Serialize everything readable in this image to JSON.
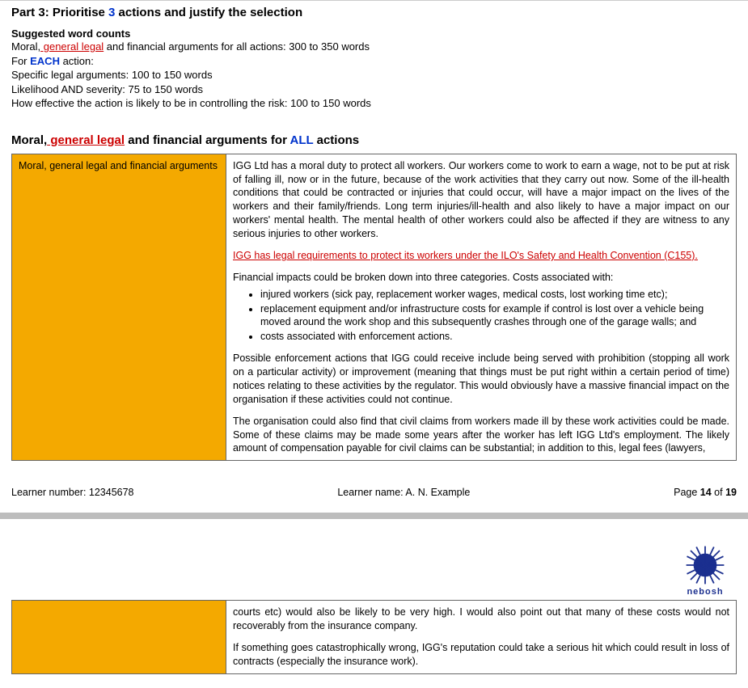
{
  "header": {
    "part_prefix": "Part 3: Prioritise ",
    "part_count": "3",
    "part_suffix": " actions and justify the selection"
  },
  "word_counts": {
    "title": "Suggested word counts",
    "line1_prefix": "Moral,",
    "line1_red": " general legal",
    "line1_suffix": " and financial arguments for all actions: 300 to 350 words",
    "each_prefix": "For ",
    "each_word": "EACH",
    "each_suffix": " action:",
    "line2": "Specific legal arguments: 100 to 150 words",
    "line3": "Likelihood AND severity: 75 to 150 words",
    "line4": "How effective the action is likely to be in controlling the risk: 100 to 150 words"
  },
  "section": {
    "prefix": "Moral,",
    "red": " general legal",
    "mid": " and financial arguments for ",
    "all": "ALL",
    "suffix": " actions"
  },
  "table1": {
    "left": "Moral, general legal and financial arguments",
    "p1": "IGG Ltd has a moral duty to protect all workers.  Our workers come to work to earn a wage, not to be put at risk of falling ill, now or in the future, because of the work activities that they carry out now.  Some of the ill-health conditions that could be contracted or injuries that could occur, will have a major impact on the lives of the workers and their family/friends.  Long term injuries/ill-health and also likely to have a major impact on our workers' mental health.  The mental health of other workers could also be affected if they are witness to any serious injuries to other workers.",
    "p2_red": "IGG has legal requirements to protect its workers under the ILO's Safety and Health Convention (C155).",
    "p3": "Financial impacts could be broken down into three categories.  Costs associated with:",
    "bullets": [
      "injured workers (sick pay, replacement worker wages, medical costs, lost working time etc);",
      "replacement equipment and/or infrastructure costs for example if control is lost over a vehicle being moved around the work shop and this subsequently crashes through one of the garage walls; and",
      "costs associated with enforcement actions."
    ],
    "p4": "Possible enforcement actions that IGG could receive include being served with prohibition (stopping all work on a particular activity) or improvement (meaning that things must be put right within a certain period of time) notices relating to these activities by the regulator.  This would obviously have a massive financial impact on the organisation if these activities could not continue.",
    "p5": "The organisation could also find that civil claims from workers made ill by these work activities could be made.  Some of these claims may be made some years after the worker has left IGG Ltd's employment.  The likely amount of compensation payable for civil claims can be substantial; in addition to this, legal fees (lawyers,"
  },
  "footer": {
    "learner_number_label": "Learner number:  ",
    "learner_number": "12345678",
    "learner_name_label": "Learner name:  ",
    "learner_name": "A. N. Example",
    "page_prefix": "Page ",
    "page_current": "14",
    "page_of": " of ",
    "page_total": "19"
  },
  "logo": {
    "text": "nebosh"
  },
  "table2": {
    "p1": "courts etc) would also be likely to be very high.  I would also point out that many of these costs would not recoverably from the insurance company.",
    "p2": "If something goes catastrophically wrong, IGG's reputation could take a serious hit which could result in loss of contracts (especially the insurance work)."
  }
}
